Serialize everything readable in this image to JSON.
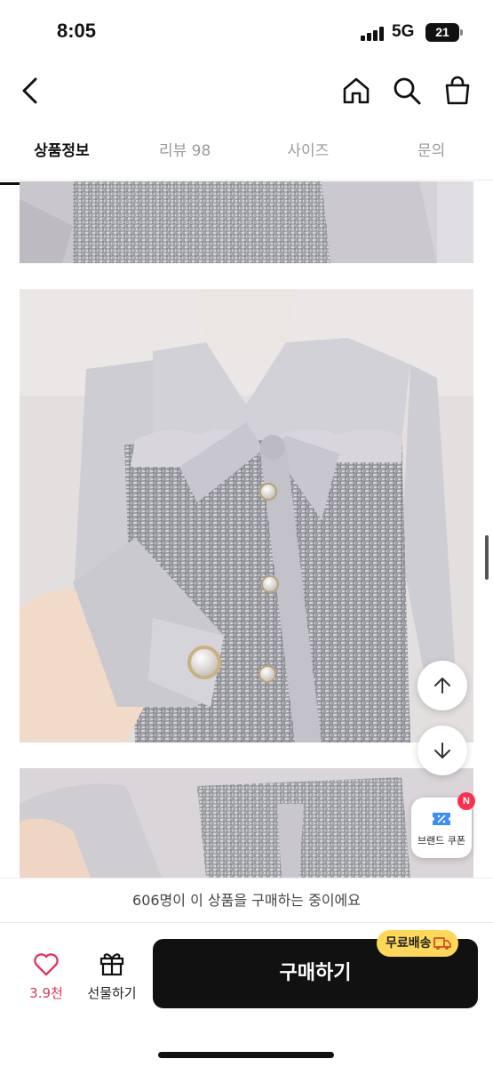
{
  "status_bar": {
    "time": "8:05",
    "network": "5G",
    "battery": "21"
  },
  "header": {
    "back_icon": "chevron-left-icon",
    "home_icon": "home-icon",
    "search_icon": "search-icon",
    "bag_icon": "shopping-bag-icon"
  },
  "tabs": [
    {
      "label": "상품정보",
      "active": true
    },
    {
      "label": "리뷰 98",
      "active": false
    },
    {
      "label": "사이즈",
      "active": false
    },
    {
      "label": "문의",
      "active": false
    }
  ],
  "floating": {
    "up_icon": "arrow-up-icon",
    "down_icon": "arrow-down-icon",
    "coupon_label": "브랜드 쿠폰",
    "coupon_badge": "N"
  },
  "notice": "606명이 이 상품을 구매하는 중이에요",
  "bottom_bar": {
    "like_count": "3.9천",
    "gift_label": "선물하기",
    "buy_label": "구매하기",
    "shipping_badge": "무료배송"
  },
  "colors": {
    "accent_pink": "#e0365a",
    "buy_button": "#111111",
    "shipping_badge": "#ffd85a"
  }
}
